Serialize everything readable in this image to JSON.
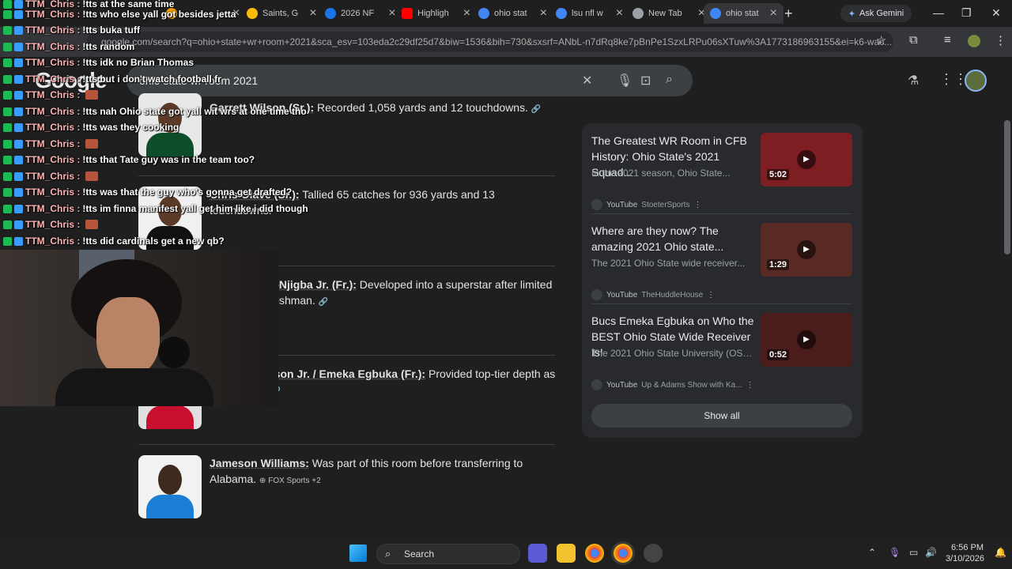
{
  "browser": {
    "tabs": [
      {
        "label": "",
        "color": "#f29900"
      },
      {
        "label": "Saints, G",
        "color": "#fbbc05"
      },
      {
        "label": "2026 NF",
        "color": "#1a73e8"
      },
      {
        "label": "Highligh",
        "color": "#ff0000"
      },
      {
        "label": "ohio stat",
        "color": "#4285f4"
      },
      {
        "label": "lsu nfl w",
        "color": "#4285f4"
      },
      {
        "label": "New Tab",
        "color": "#9aa0a6"
      },
      {
        "label": "ohio stat",
        "color": "#4285f4"
      }
    ],
    "gemini_label": "Ask Gemini",
    "url": "google.com/search?q=ohio+state+wr+room+2021&sca_esv=103eda2c29df25d7&biw=1536&bih=730&sxsrf=ANbL-n7dRq8ke7pBnPe1SzxLRPu06sXTuw%3A1773186963155&ei=k6-wac..."
  },
  "google": {
    "logo": "Google",
    "query": "ohio state wr room 2021"
  },
  "players": [
    {
      "name": "Garrett Wilson (Sr.):",
      "desc": " Recorded 1,058 yards and 12 touchdowns.",
      "source": ""
    },
    {
      "name": "Chris Olave (Sr.):",
      "desc": " Tallied 65 catches for 936 yards and 13 touchdowns.",
      "source": ""
    },
    {
      "name": "Jaxon Smith-Njigba Jr. (Fr.):",
      "desc": " Developed into a superstar after limited snaps as a freshman.",
      "source": ""
    },
    {
      "name": "Marvin Harrison Jr. / Emeka Egbuka (Fr.):",
      "desc": " Provided top-tier depth as a freshman.",
      "source": ""
    },
    {
      "name": "Jameson Williams:",
      "desc": " Was part of this room before transferring to Alabama.",
      "source": "FOX Sports +2"
    }
  ],
  "videos": {
    "items": [
      {
        "title": "The Greatest WR Room in CFB History: Ohio State's 2021 Squad...",
        "desc": "In the 2021 season, Ohio State...",
        "platform": "YouTube",
        "channel": "StoeterSports",
        "duration": "5:02"
      },
      {
        "title": "Where are they now? The amazing 2021 Ohio state...",
        "desc": "The 2021 Ohio State wide receiver...",
        "platform": "YouTube",
        "channel": "TheHuddleHouse",
        "duration": "1:29"
      },
      {
        "title": "Bucs Emeka Egbuka on Who the BEST Ohio State Wide Receiver Is!",
        "desc": "The 2021 Ohio State University (OSU)...",
        "platform": "YouTube",
        "channel": "Up & Adams Show with Ka...",
        "duration": "0:52"
      }
    ],
    "show_all": "Show all"
  },
  "chat": [
    {
      "user": "TTM_Chris :",
      "msg": "!tts at the same time"
    },
    {
      "user": "TTM_Chris :",
      "msg": "!tts who else yall got besides jetta"
    },
    {
      "user": "TTM_Chris :",
      "msg": "!tts buka tuff"
    },
    {
      "user": "TTM_Chris :",
      "msg": "!tts random"
    },
    {
      "user": "TTM_Chris :",
      "msg": "!tts idk no Brian Thomas"
    },
    {
      "user": "TTM_Chris :",
      "msg": "!tts but i don't watch football fr"
    },
    {
      "user": "TTM_Chris :",
      "msg": "",
      "emote": true
    },
    {
      "user": "TTM_Chris :",
      "msg": "!tts nah Ohio state got yall wit wrs at one time tho"
    },
    {
      "user": "TTM_Chris :",
      "msg": "!tts was they cooking"
    },
    {
      "user": "TTM_Chris :",
      "msg": "",
      "emote": true
    },
    {
      "user": "TTM_Chris :",
      "msg": "!tts that Tate guy was in the team too?"
    },
    {
      "user": "TTM_Chris :",
      "msg": "",
      "emote": true
    },
    {
      "user": "TTM_Chris :",
      "msg": "!tts was that the guy who's gonna get drafted?"
    },
    {
      "user": "TTM_Chris :",
      "msg": "!tts im finna manifest yall get him like i did though"
    },
    {
      "user": "TTM_Chris :",
      "msg": "",
      "emote": true
    },
    {
      "user": "TTM_Chris :",
      "msg": "!tts did cardinals get a new qb?"
    }
  ],
  "taskbar": {
    "search_label": "Search",
    "time": "6:56 PM",
    "date": "3/10/2026"
  }
}
